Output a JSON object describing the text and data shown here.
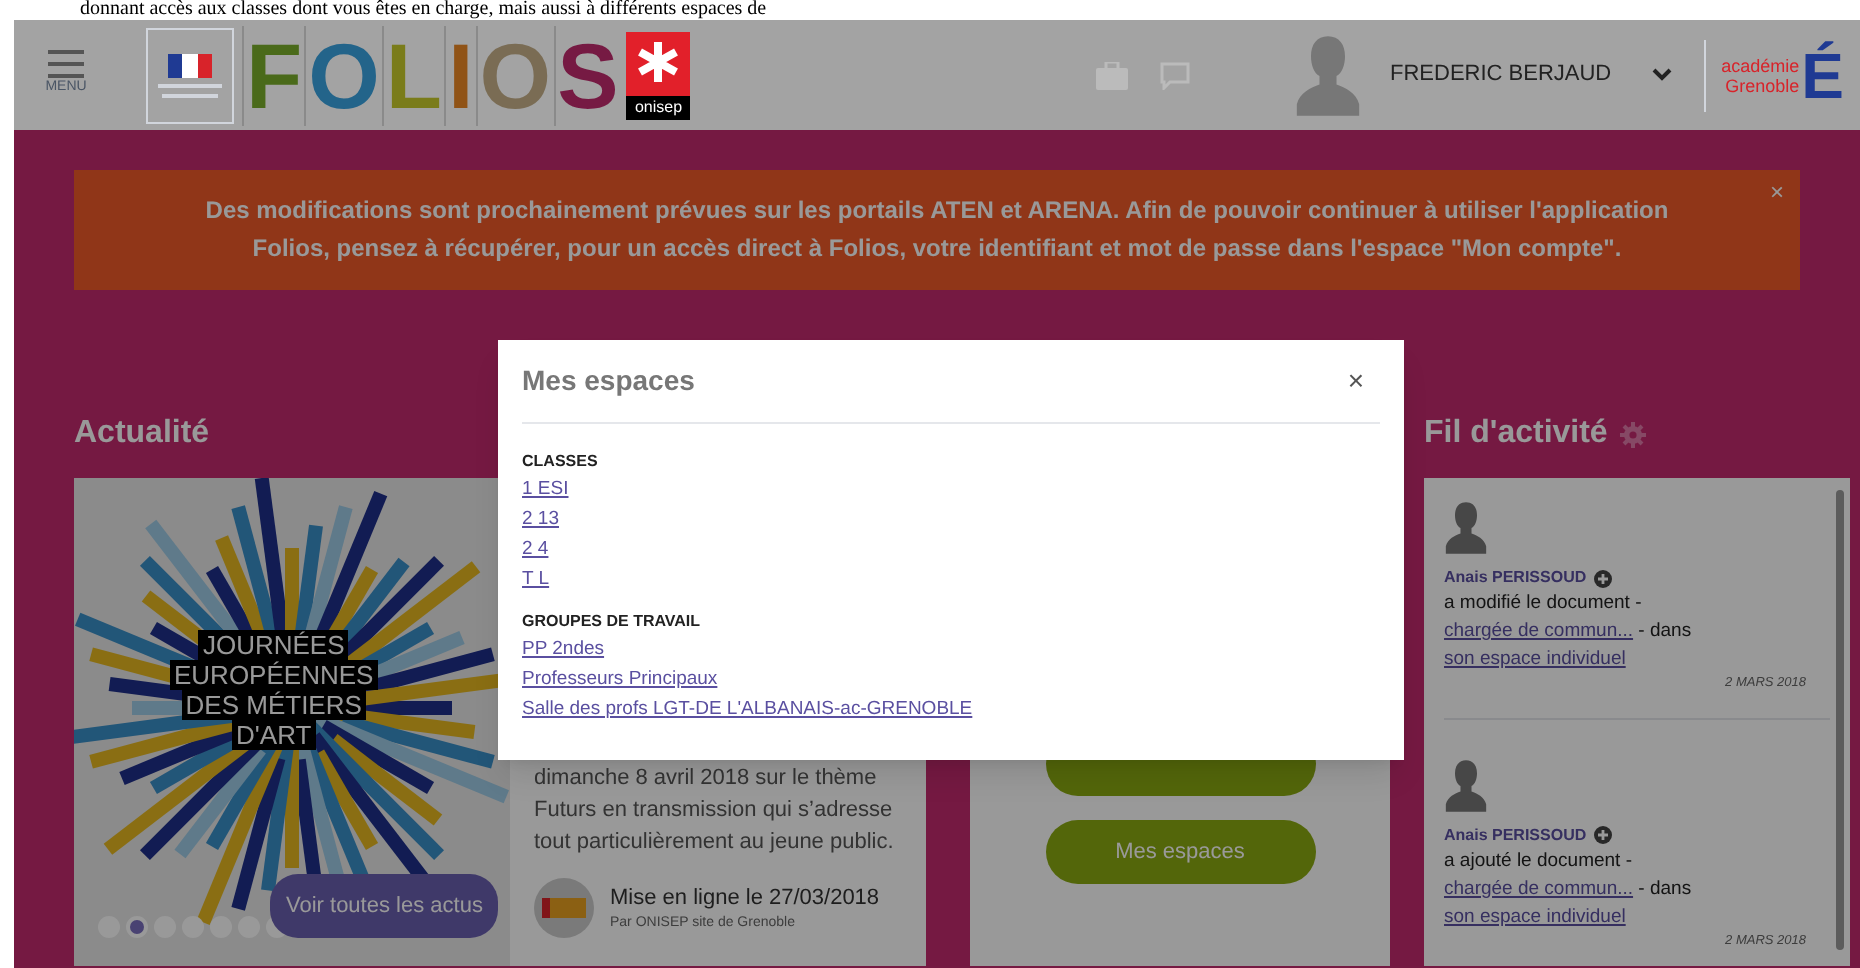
{
  "document_text": "donnant accès aux classes dont vous êtes en charge, mais aussi à différents espaces de",
  "header": {
    "menu_label": "MENU",
    "logo_letters": [
      {
        "letter": "F",
        "color": "#4a6a1a"
      },
      {
        "letter": "O",
        "color": "#23648a"
      },
      {
        "letter": "L",
        "color": "#7a7c1a"
      },
      {
        "letter": "I",
        "color": "#905316"
      },
      {
        "letter": "O",
        "color": "#7a6c54"
      },
      {
        "letter": "S",
        "color": "#761a43"
      }
    ],
    "partner_logo": "onisep",
    "user_name": "FREDERIC BERJAUD",
    "academy_lines": [
      "académie",
      "Grenoble"
    ],
    "academy_letter": "É"
  },
  "banner": {
    "message": "Des modifications sont prochainement prévues sur les portails ATEN et ARENA. Afin de pouvoir continuer à utiliser l'application Folios, pensez à récupérer, pour un accès direct à Folios, votre identifiant et mot de passe dans l'espace \"Mon compte\".",
    "close": "×"
  },
  "news": {
    "title": "Actualité",
    "image_lines": [
      "JOURNÉES",
      "EUROPÉENNES",
      "DES MÉTIERS",
      "D'ART"
    ],
    "dots": [
      {
        "selected": false
      },
      {
        "selected": true
      },
      {
        "selected": false
      },
      {
        "selected": false
      },
      {
        "selected": false
      },
      {
        "selected": false
      },
      {
        "selected": false
      }
    ],
    "more_button": "Voir toutes les actus",
    "paragraph": "dimanche 8 avril 2018 sur le thème Futurs en transmission qui s’adresse tout particulièrement au jeune public.",
    "published": "Mise en ligne le 27/03/2018",
    "author": "Par ONISEP site de Grenoble"
  },
  "actions": {
    "button": "Mes espaces"
  },
  "activity": {
    "title": "Fil d'activité",
    "items": [
      {
        "name": "Anais PERISSOUD",
        "action": "a modifié le document -",
        "document": "chargée de commun...",
        "connector": "- dans",
        "space": "son espace individuel",
        "date": "2 MARS 2018"
      },
      {
        "name": "Anais PERISSOUD",
        "action": "a ajouté le document -",
        "document": "chargée de commun...",
        "connector": "- dans",
        "space": "son espace individuel",
        "date": "2 MARS 2018"
      }
    ]
  },
  "modal": {
    "title": "Mes espaces",
    "close": "×",
    "sections": [
      {
        "heading": "CLASSES",
        "links": [
          "1 ESI",
          "2 13",
          "2 4",
          "T L"
        ]
      },
      {
        "heading": "GROUPES DE TRAVAIL",
        "links": [
          "PP 2ndes",
          "Professeurs Principaux",
          "Salle des profs LGT-DE L'ALBANAIS-ac-GRENOBLE"
        ]
      }
    ]
  }
}
